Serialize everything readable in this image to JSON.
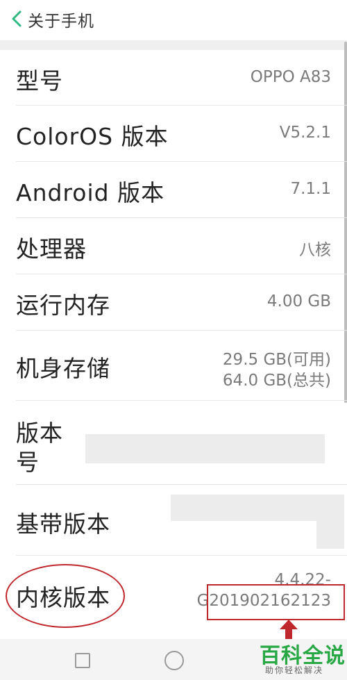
{
  "header": {
    "title": "关于手机",
    "back_icon": "chevron-left-icon",
    "accent": "#2eb882"
  },
  "items": [
    {
      "label": "型号",
      "value": "OPPO A83"
    },
    {
      "label": "ColorOS 版本",
      "value": "V5.2.1"
    },
    {
      "label": "Android 版本",
      "value": "7.1.1"
    },
    {
      "label": "处理器",
      "value": "八核"
    },
    {
      "label": "运行内存",
      "value": "4.00 GB"
    },
    {
      "label": "机身存储",
      "value_line1": "29.5 GB(可用)",
      "value_line2": "64.0 GB(总共)"
    },
    {
      "label_line1": "版本",
      "label_line2": "号",
      "value": ""
    },
    {
      "label": "基带版本",
      "value": ""
    },
    {
      "label": "内核版本",
      "value_line1": "4.4.22-",
      "value_line2": "G201902162123"
    }
  ],
  "annotation_color": "#c0272d",
  "navbar": {
    "icons": [
      "square-icon",
      "circle-icon"
    ]
  },
  "watermark": {
    "title": "百科全说",
    "subtitle": "助你轻松解决",
    "color": "#28a745"
  }
}
